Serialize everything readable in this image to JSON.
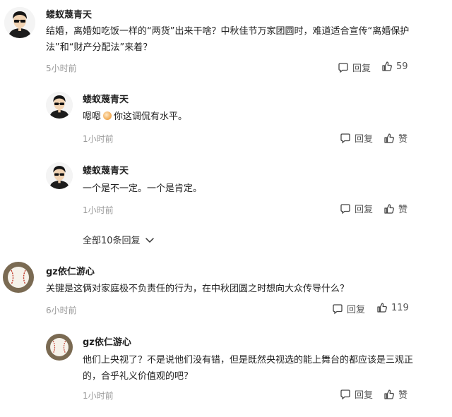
{
  "comments": [
    {
      "user": "蝼蚁蔑青天",
      "text": "结婚，离婚如吃饭一样的“两货”出来干啥？中秋佳节万家团圆时，难道适合宣传“离婚保护法”和“财产分配法”来着？",
      "time": "5小时前",
      "reply_label": "回复",
      "likes": "59",
      "avatar_icon": "man-sunglasses-avatar"
    },
    {
      "user": "蝼蚁蔑青天",
      "text_before": "嗯嗯",
      "text_after": "你这调侃有水平。",
      "time": "1小时前",
      "reply_label": "回复",
      "like_label": "赞",
      "avatar_icon": "man-sunglasses-avatar"
    },
    {
      "user": "蝼蚁蔑青天",
      "text": "一个是不一定。一个是肯定。",
      "time": "1小时前",
      "reply_label": "回复",
      "like_label": "赞",
      "avatar_icon": "man-sunglasses-avatar"
    },
    {
      "user": "gz依仁游心",
      "text": "关键是这俩对家庭极不负责任的行为，在中秋团圆之时想向大众传导什么？",
      "time": "6小时前",
      "reply_label": "回复",
      "likes": "119",
      "avatar_icon": "baseball-avatar"
    },
    {
      "user": "gz依仁游心",
      "text": "他们上央视了？不是说他们没有错，但是既然央视选的能上舞台的都应该是三观正的，合乎礼义价值观的吧？",
      "time": "1小时前",
      "reply_label": "回复",
      "like_label": "赞",
      "avatar_icon": "baseball-avatar"
    }
  ],
  "expand_replies": "全部10条回复",
  "colors": {
    "text": "#222222",
    "muted": "#999999",
    "action": "#555555"
  }
}
